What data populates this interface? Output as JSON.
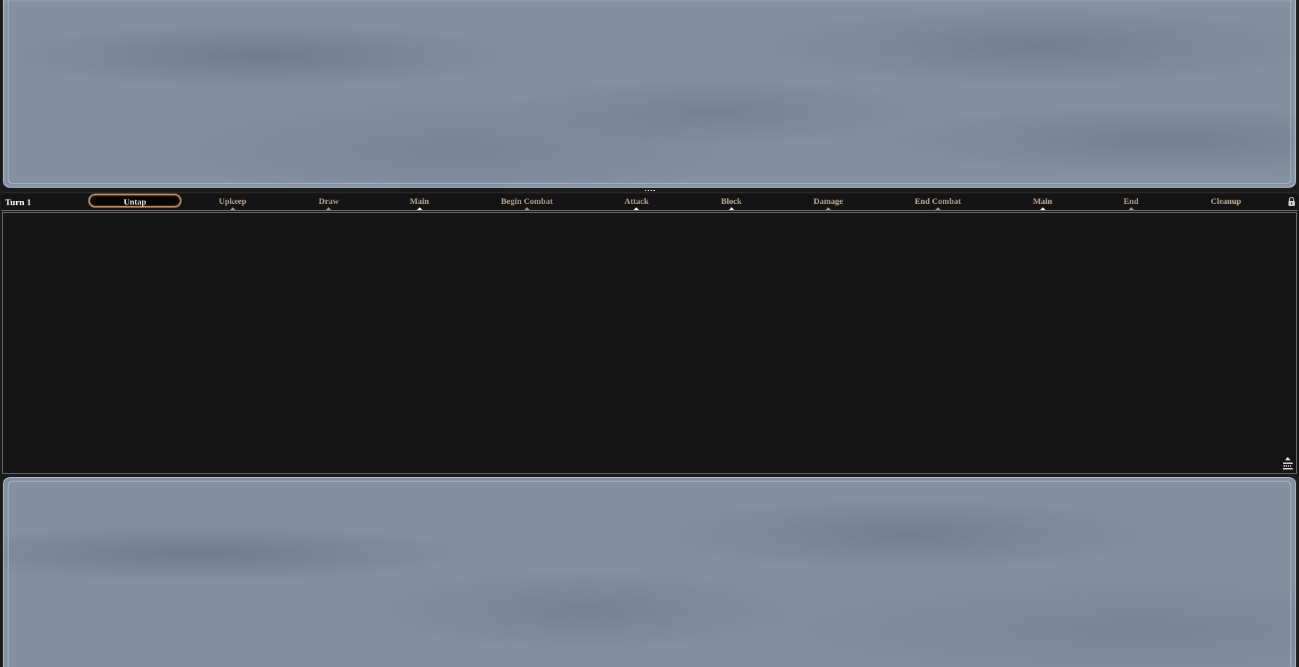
{
  "battlefield": {
    "opponent_zone": "opponent-battlefield",
    "player_zone": "player-battlefield"
  },
  "phase_bar": {
    "turn_label": "Turn 1",
    "active_phase": "Untap",
    "phases": [
      {
        "label": "Upkeep"
      },
      {
        "label": "Draw"
      },
      {
        "label": "Main"
      },
      {
        "label": "Begin Combat"
      },
      {
        "label": "Attack"
      },
      {
        "label": "Block"
      },
      {
        "label": "Damage"
      },
      {
        "label": "End Combat"
      },
      {
        "label": "Main"
      },
      {
        "label": "End"
      },
      {
        "label": "Cleanup"
      }
    ],
    "lock_icon": "lock-icon"
  },
  "stack": {
    "expand_icon": "expand-up-icon"
  },
  "colors": {
    "battlefield": "#8390a2",
    "stack_bg": "#151515",
    "phase_text": "#b8a98f",
    "active_outline": "#c08a5e"
  }
}
